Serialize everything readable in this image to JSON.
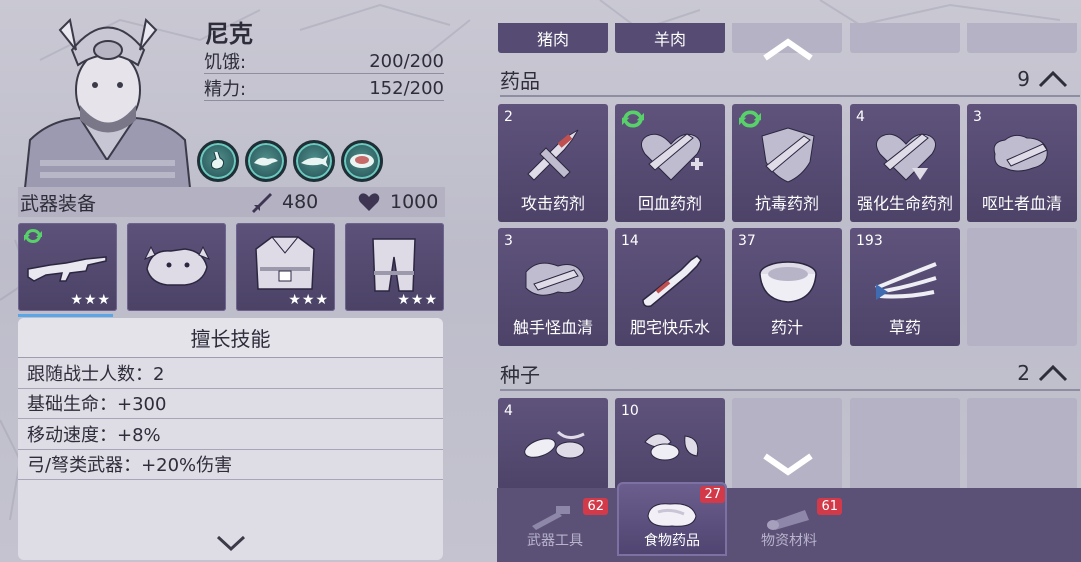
{
  "character": {
    "name": "尼克",
    "stats": [
      {
        "label": "饥饿:",
        "value": "200/200"
      },
      {
        "label": "精力:",
        "value": "152/200"
      }
    ],
    "skill_icons": [
      "stomach-icon",
      "lizard-icon",
      "shark-icon",
      "plate-icon"
    ]
  },
  "equipment": {
    "title": "武器装备",
    "attack": "480",
    "health": "1000",
    "slots": [
      {
        "icon": "rifle-icon",
        "stars": "★★★",
        "upgradable": true
      },
      {
        "icon": "boar-mask-icon",
        "stars": ""
      },
      {
        "icon": "jacket-icon",
        "stars": "★★★"
      },
      {
        "icon": "pants-icon",
        "stars": "★★★"
      }
    ]
  },
  "skills": {
    "title": "擅长技能",
    "lines": [
      "跟随战士人数：2",
      "基础生命：+300",
      "移动速度：+8%",
      "弓/弩类武器：+20%伤害"
    ]
  },
  "food_row": [
    "猪肉",
    "羊肉"
  ],
  "medicine": {
    "title": "药品",
    "count": "9",
    "items": [
      {
        "qty": "2",
        "name": "攻击药剂",
        "icon": "syringe-sword-icon"
      },
      {
        "qty": "",
        "name": "回血药剂",
        "icon": "syringe-heart-icon",
        "refresh": true
      },
      {
        "qty": "",
        "name": "抗毒药剂",
        "icon": "syringe-shield-icon",
        "refresh": true
      },
      {
        "qty": "4",
        "name": "强化生命药剂",
        "icon": "syringe-heart-plus-icon"
      },
      {
        "qty": "3",
        "name": "呕吐者血清",
        "icon": "vial-icon"
      },
      {
        "qty": "3",
        "name": "触手怪血清",
        "icon": "vial-tentacle-icon"
      },
      {
        "qty": "14",
        "name": "肥宅快乐水",
        "icon": "soda-bottle-icon"
      },
      {
        "qty": "37",
        "name": "药汁",
        "icon": "bowl-icon"
      },
      {
        "qty": "193",
        "name": "草药",
        "icon": "herb-icon"
      }
    ]
  },
  "seeds": {
    "title": "种子",
    "count": "2",
    "items": [
      {
        "qty": "4",
        "icon": "seed-icon"
      },
      {
        "qty": "10",
        "icon": "seed-leaf-icon"
      }
    ]
  },
  "bottom_tabs": [
    {
      "label": "武器工具",
      "badge": "62",
      "icon": "tools-icon",
      "active": false
    },
    {
      "label": "食物药品",
      "badge": "27",
      "icon": "meat-icon",
      "active": true
    },
    {
      "label": "物资材料",
      "badge": "61",
      "icon": "log-icon",
      "active": false
    }
  ]
}
